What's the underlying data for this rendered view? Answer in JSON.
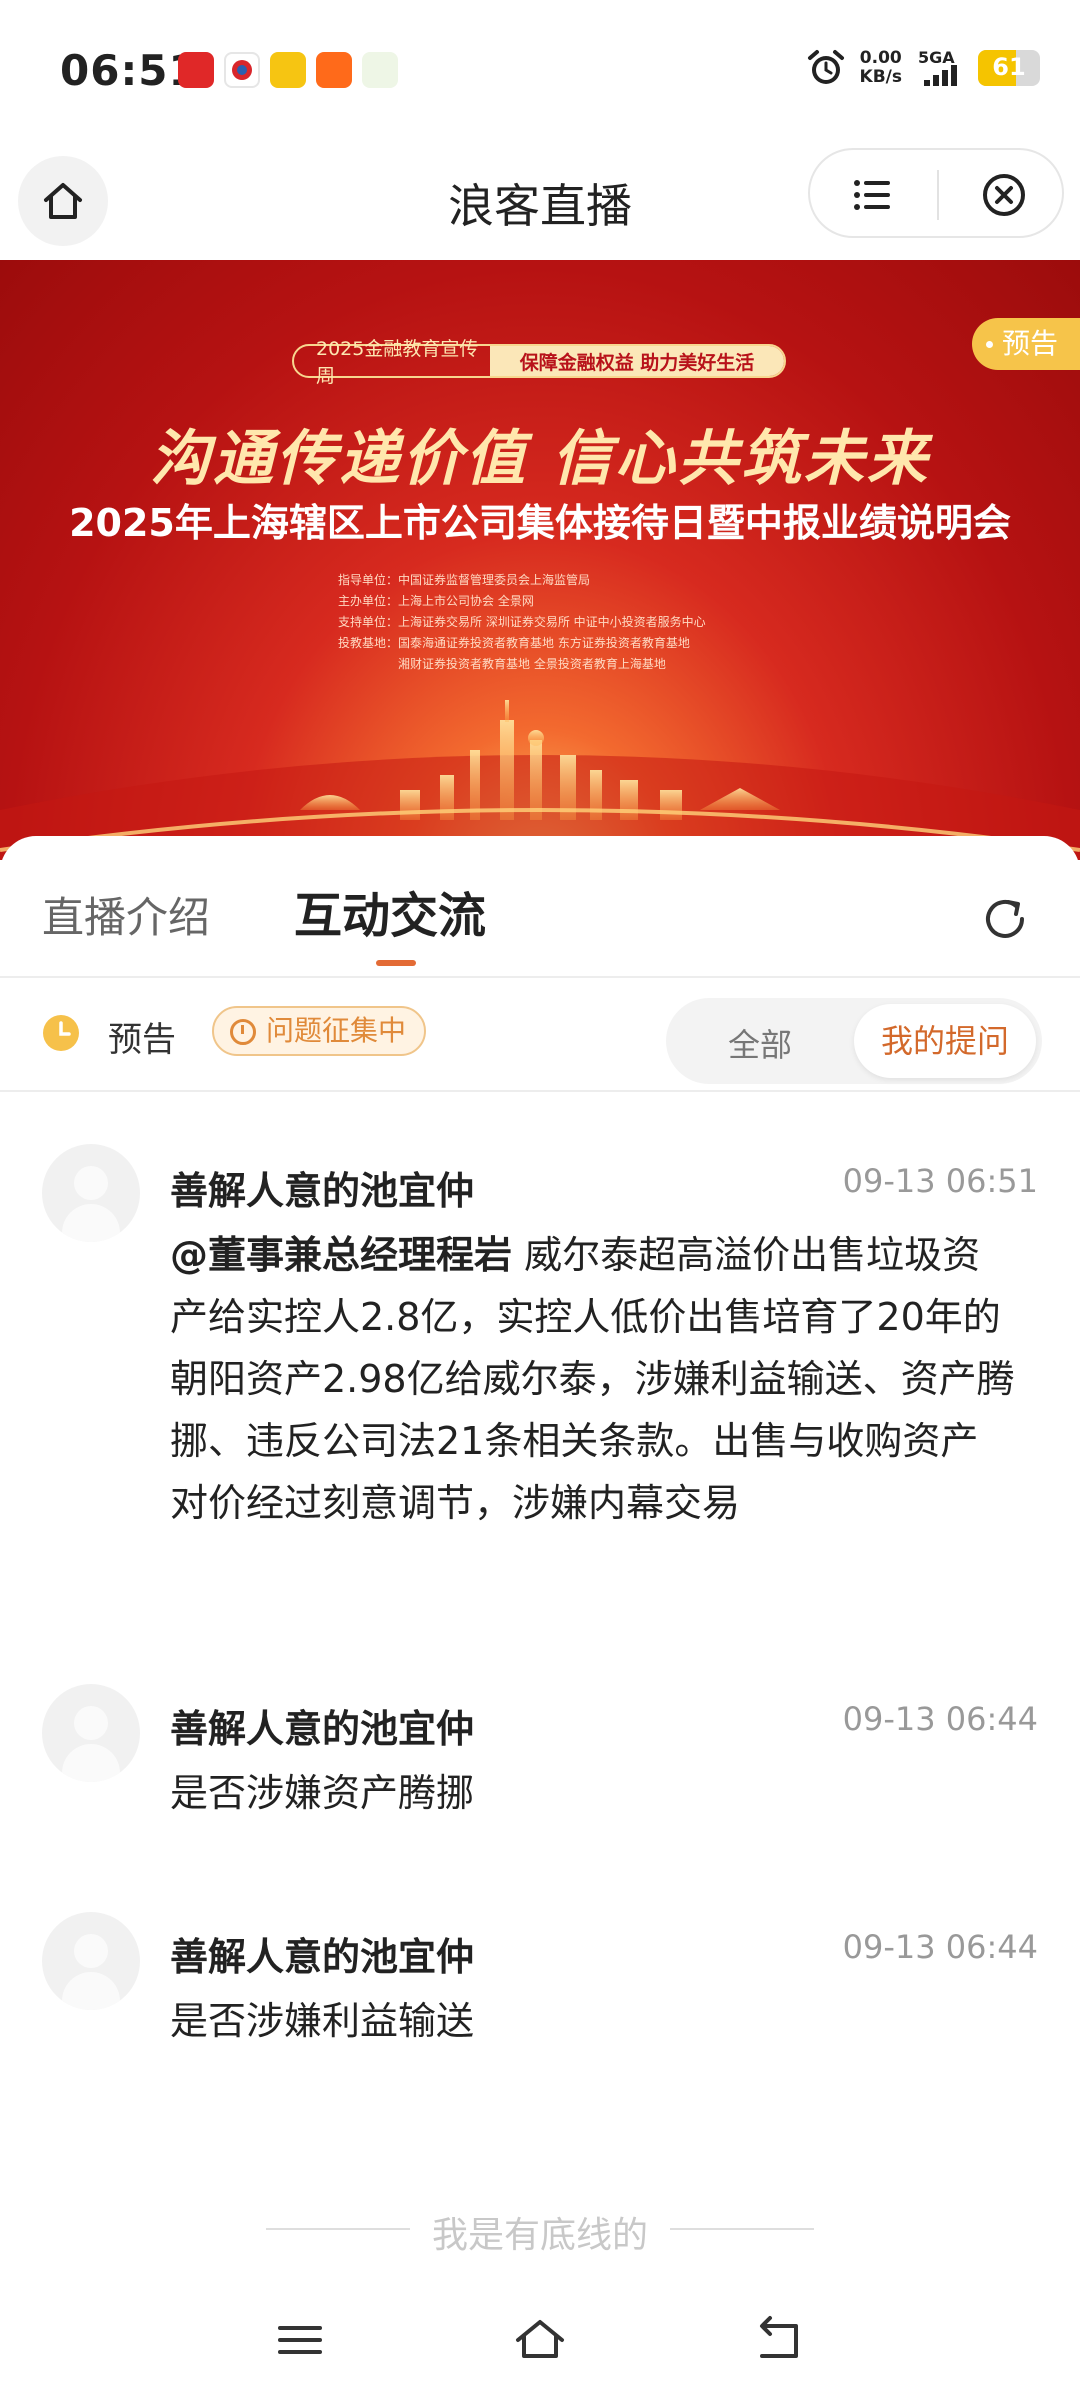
{
  "status_bar": {
    "time": "06:51",
    "net_speed_value": "0.00",
    "net_speed_unit": "KB/s",
    "signal_label": "5GA",
    "battery_level": 61,
    "battery_text": "61"
  },
  "header": {
    "title": "浪客直播"
  },
  "banner": {
    "badge": "预告",
    "pill_left": "2025金融教育宣传周",
    "pill_right": "保障金融权益  助力美好生活",
    "slogan": "沟通传递价值  信心共筑未来",
    "event_title": "2025年上海辖区上市公司集体接待日暨中报业绩说明会",
    "credits": [
      "指导单位：中国证券监督管理委员会上海监管局",
      "主办单位：上海上市公司协会  全景网",
      "支持单位：上海证券交易所  深圳证券交易所  中证中小投资者服务中心",
      "投教基地：国泰海通证券投资者教育基地  东方证券投资者教育基地",
      "湘财证券投资者教育基地  全景投资者教育上海基地"
    ]
  },
  "tabs": {
    "intro": "直播介绍",
    "interact": "互动交流"
  },
  "filter": {
    "status": "预告",
    "collecting": "问题征集中",
    "all": "全部",
    "mine": "我的提问"
  },
  "comments": [
    {
      "user": "善解人意的池宜仲",
      "time": "09-13 06:51",
      "mention": "@董事兼总经理程岩",
      "text": " 威尔泰超高溢价出售垃圾资产给实控人2.8亿，实控人低价出售培育了20年的朝阳资产2.98亿给威尔泰，涉嫌利益输送、资产腾挪、违反公司法21条相关条款。出售与收购资产对价经过刻意调节，涉嫌内幕交易"
    },
    {
      "user": "善解人意的池宜仲",
      "time": "09-13 06:44",
      "mention": "",
      "text": "是否涉嫌资产腾挪"
    },
    {
      "user": "善解人意的池宜仲",
      "time": "09-13 06:44",
      "mention": "",
      "text": "是否涉嫌利益输送"
    }
  ],
  "end_text": "我是有底线的",
  "icons": {
    "home": "home-icon",
    "menu": "list-icon",
    "close": "close-circle-icon",
    "refresh": "refresh-icon",
    "clock": "clock-icon",
    "nav_menu": "menu-icon",
    "nav_home": "home-icon",
    "nav_back": "back-icon"
  },
  "colors": {
    "accent": "#d3692b",
    "tab_underline": "#e36b35",
    "badge": "#f6c44a",
    "banner_red": "#c91b17"
  }
}
